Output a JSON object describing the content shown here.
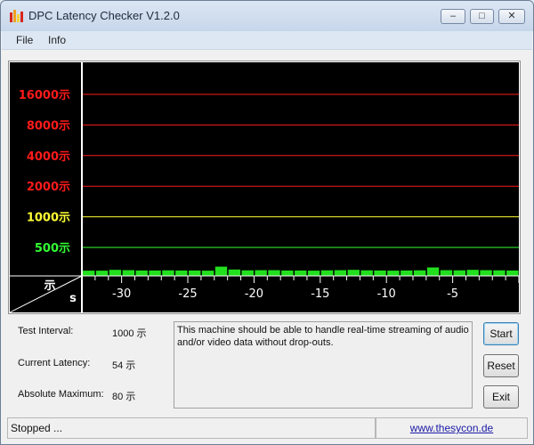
{
  "window": {
    "title": "DPC Latency Checker V1.2.0",
    "minimize_glyph": "–",
    "maximize_glyph": "□",
    "close_glyph": "✕"
  },
  "menu": {
    "items": [
      "File",
      "Info"
    ]
  },
  "chart_data": {
    "type": "bar",
    "unit_glyph": "示",
    "y_scale": "log2",
    "y_levels": [
      {
        "value": 16000,
        "label": "16000示",
        "color": "#ff1a1a"
      },
      {
        "value": 8000,
        "label": "8000示",
        "color": "#ff1a1a"
      },
      {
        "value": 4000,
        "label": "4000示",
        "color": "#ff1a1a"
      },
      {
        "value": 2000,
        "label": "2000示",
        "color": "#ff1a1a"
      },
      {
        "value": 1000,
        "label": "1000示",
        "color": "#ffff33"
      },
      {
        "value": 500,
        "label": "500示",
        "color": "#33ff33"
      }
    ],
    "x_ticks": [
      {
        "value": -30,
        "label": "-30"
      },
      {
        "value": -25,
        "label": "-25"
      },
      {
        "value": -20,
        "label": "-20"
      },
      {
        "value": -15,
        "label": "-15"
      },
      {
        "value": -10,
        "label": "-10"
      },
      {
        "value": -5,
        "label": "-5"
      }
    ],
    "corner_y_label": "示",
    "corner_x_label": "s",
    "xlim": [
      -33,
      0
    ],
    "bar_color": "#22e01e",
    "values": [
      55,
      55,
      60,
      58,
      56,
      56,
      57,
      56,
      56,
      55,
      80,
      62,
      57,
      58,
      58,
      56,
      56,
      55,
      57,
      58,
      60,
      57,
      56,
      55,
      56,
      57,
      75,
      58,
      57,
      60,
      58,
      57,
      56
    ]
  },
  "stats": {
    "test_interval_label": "Test Interval:",
    "test_interval_value": "1000 示",
    "current_latency_label": "Current Latency:",
    "current_latency_value": "54 示",
    "absolute_maximum_label": "Absolute Maximum:",
    "absolute_maximum_value": "80 示"
  },
  "message": "This machine should be able to handle real-time streaming of audio and/or video data without drop-outs.",
  "buttons": {
    "start": "Start",
    "reset": "Reset",
    "exit": "Exit"
  },
  "status": {
    "text": "Stopped ...",
    "link": "www.thesycon.de"
  },
  "colors": {
    "chart_background": "#000000",
    "axis": "#ffffff",
    "icon_bars": [
      "#d8261c",
      "#f0a020",
      "#f5d23a"
    ]
  }
}
